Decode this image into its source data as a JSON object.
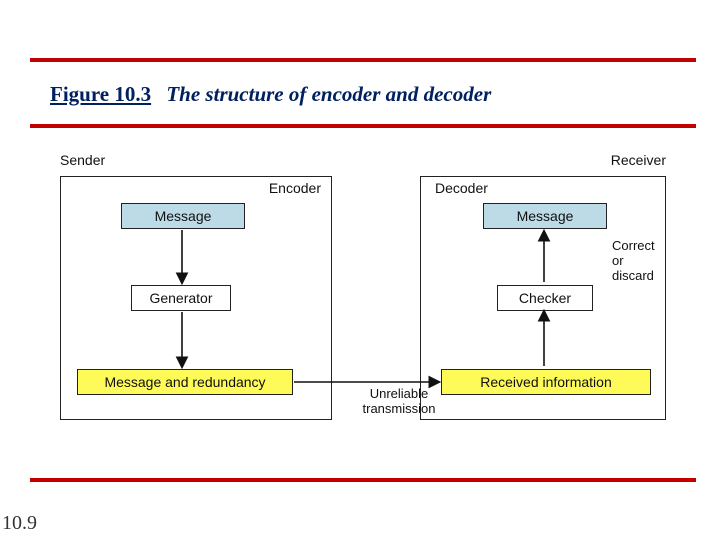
{
  "figure": {
    "number": "Figure 10.3",
    "caption": "The structure of encoder and decoder"
  },
  "page_footer": "10.9",
  "diagram": {
    "sender_label": "Sender",
    "receiver_label": "Receiver",
    "encoder_title": "Encoder",
    "decoder_title": "Decoder",
    "encoder": {
      "message": "Message",
      "generator": "Generator",
      "message_and_redundancy": "Message and redundancy"
    },
    "decoder": {
      "message": "Message",
      "checker": "Checker",
      "received_info": "Received information"
    },
    "correct_or_discard": "Correct or\ndiscard",
    "unreliable_transmission": "Unreliable transmission"
  }
}
